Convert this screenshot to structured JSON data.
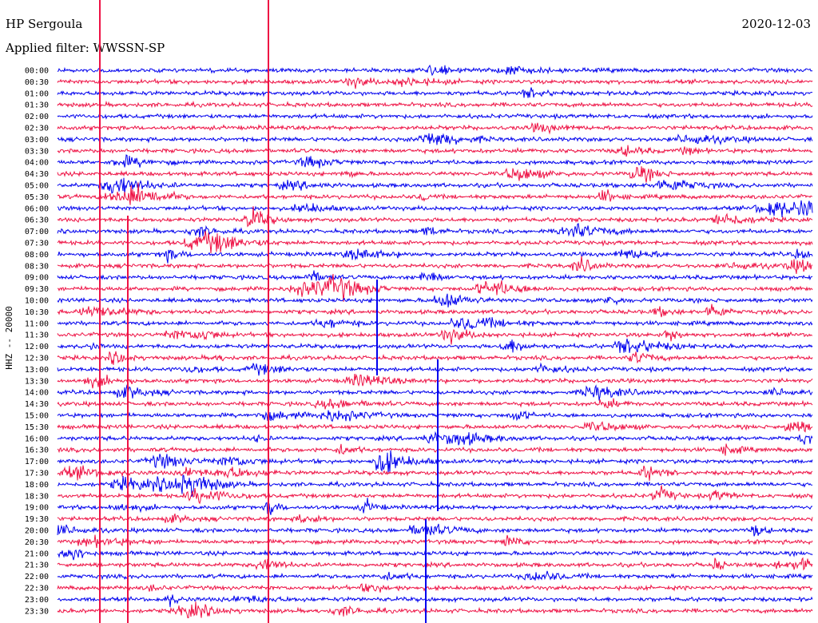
{
  "header": {
    "station": "HP Sergoula",
    "date": "2020-12-03",
    "filter": "Applied filter: WWSSN-SP"
  },
  "chart_data": {
    "type": "line",
    "title": "HP Sergoula",
    "date": "2020-12-03",
    "filter": "Applied filter: WWSSN-SP",
    "ylabel": "HHZ -- 20000",
    "row_labels": [
      "00:00",
      "00:30",
      "01:00",
      "01:30",
      "02:00",
      "02:30",
      "03:00",
      "03:30",
      "04:00",
      "04:30",
      "05:00",
      "05:30",
      "06:00",
      "06:30",
      "07:00",
      "07:30",
      "08:00",
      "08:30",
      "09:00",
      "09:30",
      "10:00",
      "10:30",
      "11:00",
      "11:30",
      "12:00",
      "12:30",
      "13:00",
      "13:30",
      "14:00",
      "14:30",
      "15:00",
      "15:30",
      "16:00",
      "16:30",
      "17:00",
      "17:30",
      "18:00",
      "18:30",
      "19:00",
      "19:30",
      "20:00",
      "20:30",
      "21:00",
      "21:30",
      "22:00",
      "22:30",
      "23:00",
      "23:30"
    ],
    "series_colors": [
      "#0000ee",
      "#ee1144"
    ],
    "minutes_per_row": 30
  }
}
